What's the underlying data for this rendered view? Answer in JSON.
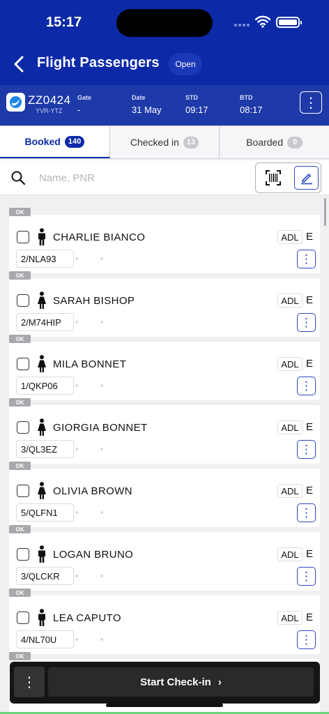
{
  "status_bar": {
    "time": "15:17"
  },
  "header": {
    "title": "Flight Passengers",
    "status": "Open"
  },
  "flight": {
    "number": "ZZ0424",
    "route": "YVR-YTZ",
    "gate_label": "Gate",
    "gate": "-",
    "date_label": "Date",
    "date": "31 May",
    "std_label": "STD",
    "std": "09:17",
    "btd_label": "BTD",
    "btd": "08:17"
  },
  "tabs": [
    {
      "label": "Booked",
      "count": "140"
    },
    {
      "label": "Checked in",
      "count": "13"
    },
    {
      "label": "Boarded",
      "count": "0"
    }
  ],
  "search": {
    "placeholder": "Name, PNR"
  },
  "passengers": [
    {
      "status": "OK",
      "name": "CHARLIE BIANCO",
      "type": "ADL",
      "cabin": "E",
      "pnr": "2/NLA93",
      "gender": "male"
    },
    {
      "status": "OK",
      "name": "SARAH BISHOP",
      "type": "ADL",
      "cabin": "E",
      "pnr": "2/M74HIP",
      "gender": "female"
    },
    {
      "status": "OK",
      "name": "MILA BONNET",
      "type": "ADL",
      "cabin": "E",
      "pnr": "1/QKP06",
      "gender": "female"
    },
    {
      "status": "OK",
      "name": "GIORGIA BONNET",
      "type": "ADL",
      "cabin": "E",
      "pnr": "3/QL3EZ",
      "gender": "female"
    },
    {
      "status": "OK",
      "name": "OLIVIA BROWN",
      "type": "ADL",
      "cabin": "E",
      "pnr": "5/QLFN1",
      "gender": "female"
    },
    {
      "status": "OK",
      "name": "LOGAN BRUNO",
      "type": "ADL",
      "cabin": "E",
      "pnr": "3/QLCKR",
      "gender": "male"
    },
    {
      "status": "OK",
      "name": "LEA CAPUTO",
      "type": "ADL",
      "cabin": "E",
      "pnr": "4/NL70U",
      "gender": "male"
    },
    {
      "status": "OK"
    }
  ],
  "bottom": {
    "more": "⋮",
    "start_label": "Start Check-in",
    "chevron": "›"
  },
  "colors": {
    "brand": "#0c2aa8",
    "accent": "#2c48c0"
  }
}
